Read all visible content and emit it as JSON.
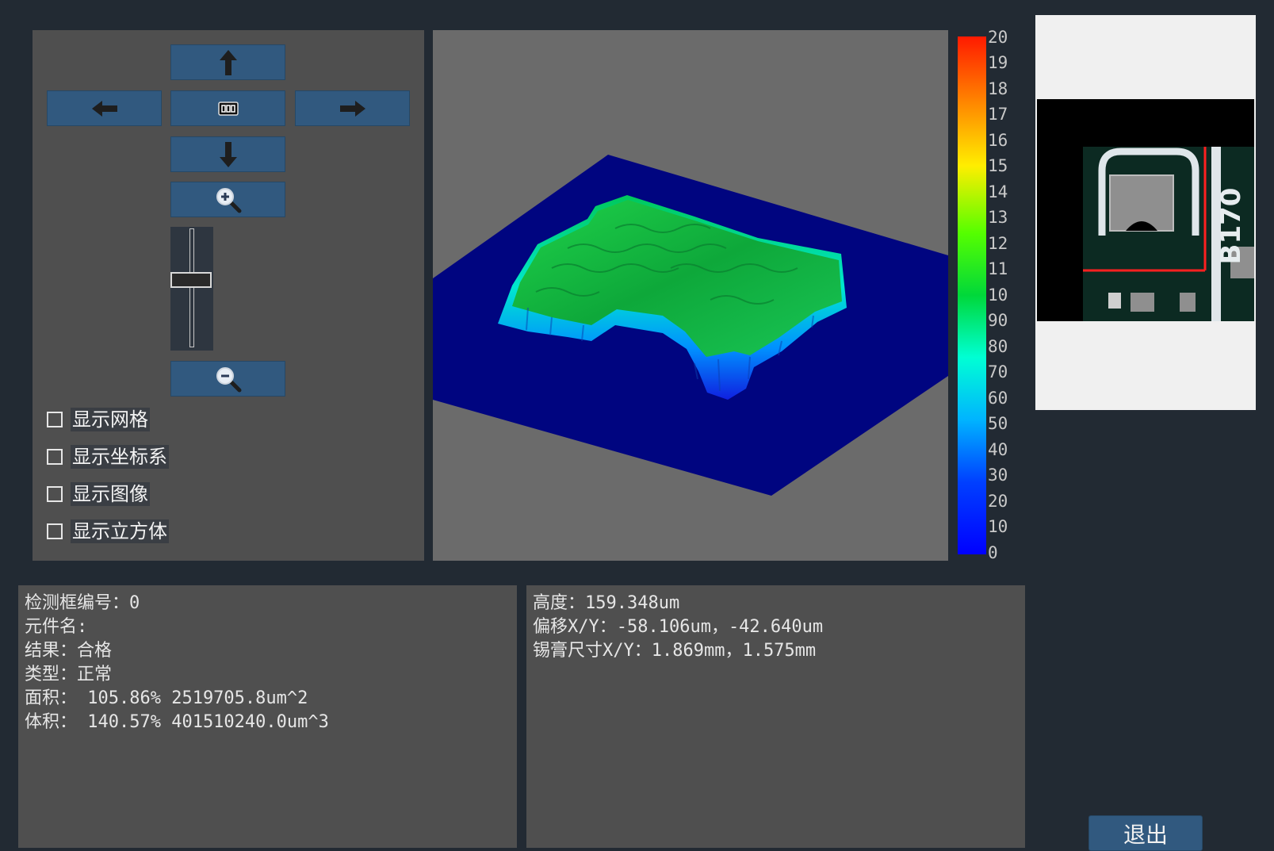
{
  "controls": {
    "nav_buttons": [
      "up",
      "left",
      "reset",
      "right",
      "down",
      "zoom-in",
      "zoom-out"
    ],
    "zoom_slider": {
      "value_fraction": 0.42
    },
    "checkboxes": [
      {
        "label": "显示网格",
        "checked": false
      },
      {
        "label": "显示坐标系",
        "checked": false
      },
      {
        "label": "显示图像",
        "checked": false
      },
      {
        "label": "显示立方体",
        "checked": false
      }
    ]
  },
  "legend": {
    "labels": [
      "20",
      "19",
      "18",
      "17",
      "16",
      "15",
      "14",
      "13",
      "12",
      "11",
      "10",
      "90",
      "80",
      "70",
      "60",
      "50",
      "40",
      "30",
      "20",
      "10",
      "0"
    ]
  },
  "info_left": {
    "lines": [
      "检测框编号：0",
      "元件名:",
      "结果：合格",
      "类型：正常",
      "面积： 105.86% 2519705.8um^2",
      "体积： 140.57% 401510240.0um^3"
    ]
  },
  "info_right": {
    "lines": [
      "高度：159.348um",
      "偏移X/Y：-58.106um，-42.640um",
      "锡膏尺寸X/Y：1.869mm，1.575mm"
    ]
  },
  "thumbnail": {
    "text": "B170"
  },
  "exit_label": "退出",
  "colors": {
    "panel": "#4f4f4f",
    "button": "#31597f",
    "plane": "#000580",
    "background": "#222a33"
  }
}
